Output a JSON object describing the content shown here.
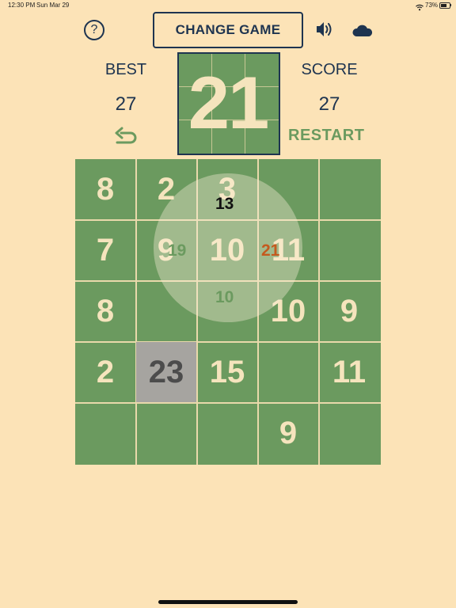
{
  "status_bar": {
    "time": "12:30 PM",
    "date": "Sun Mar 29",
    "battery": "73%"
  },
  "header": {
    "help_label": "?",
    "change_game_label": "CHANGE GAME"
  },
  "icons": {
    "help": "question-icon",
    "sound": "speaker-icon",
    "weather": "cloud-moon-icon",
    "undo": "undo-arrow-icon"
  },
  "stats": {
    "best_label": "BEST",
    "best_value": "27",
    "score_label": "SCORE",
    "score_value": "27"
  },
  "target": "21",
  "restart_label": "RESTART",
  "board": {
    "rows": [
      [
        "8",
        "2",
        "3",
        "",
        ""
      ],
      [
        "7",
        "9",
        "10",
        "11",
        ""
      ],
      [
        "8",
        "",
        "",
        "10",
        "9"
      ],
      [
        "2",
        "23",
        "15",
        "",
        "11"
      ],
      [
        "",
        "",
        "",
        "9",
        ""
      ]
    ],
    "highlighted_cell": {
      "row": 3,
      "col": 1
    }
  },
  "neighbor_sums": {
    "top": "13",
    "left": "19",
    "right": "21",
    "bottom": "10"
  },
  "colors": {
    "background": "#fce3b7",
    "tile_green": "#6b9a5f",
    "tile_text": "#f5e4bd",
    "navy": "#1e3450",
    "grey_tile": "#a6a4a0",
    "highlight_sum": "#c45a1e"
  }
}
